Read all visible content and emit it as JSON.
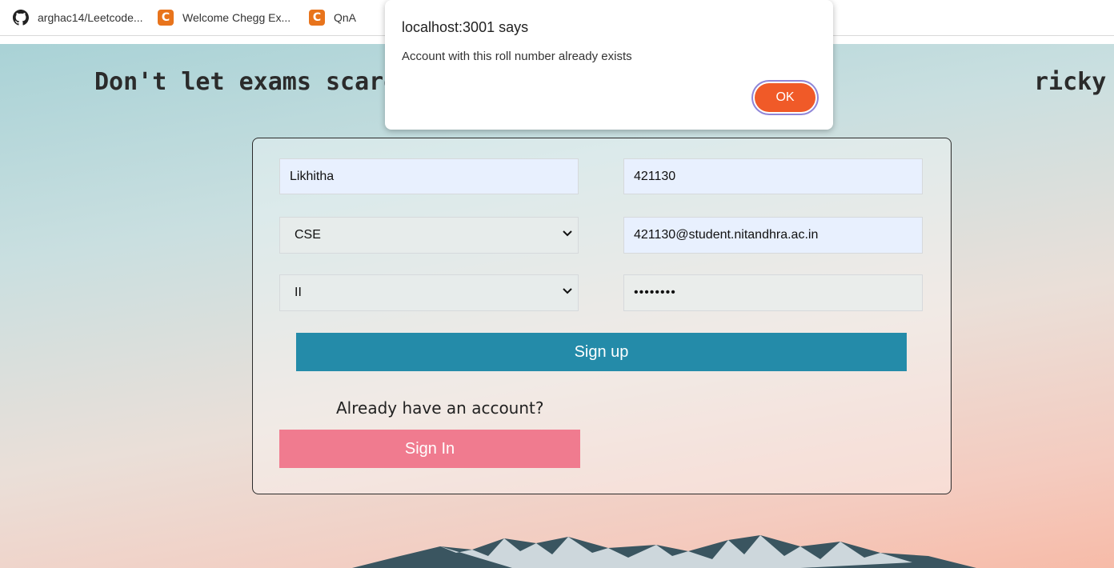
{
  "bookmarks": [
    {
      "label": "arghac14/Leetcode...",
      "icon": "github-icon"
    },
    {
      "label": "Welcome Chegg Ex...",
      "icon": "chegg-icon"
    },
    {
      "label": "QnA",
      "icon": "chegg-icon"
    }
  ],
  "page": {
    "tagline": "Don't let exams scare yo                                         ricky questions together"
  },
  "form": {
    "name_value": "Likhitha",
    "roll_value": "421130",
    "branch_value": "CSE",
    "email_value": "421130@student.nitandhra.ac.in",
    "year_value": "II",
    "password_masked": "••••••••",
    "signup_label": "Sign up",
    "have_account_text": "Already have an account?",
    "signin_label": "Sign In"
  },
  "dialog": {
    "title": "localhost:3001 says",
    "message": "Account with this roll number already exists",
    "ok_label": "OK"
  },
  "colors": {
    "signup_button": "#248ba9",
    "signin_button": "#f07b8f",
    "ok_button": "#f05a28",
    "chegg_icon": "#e8741c"
  }
}
